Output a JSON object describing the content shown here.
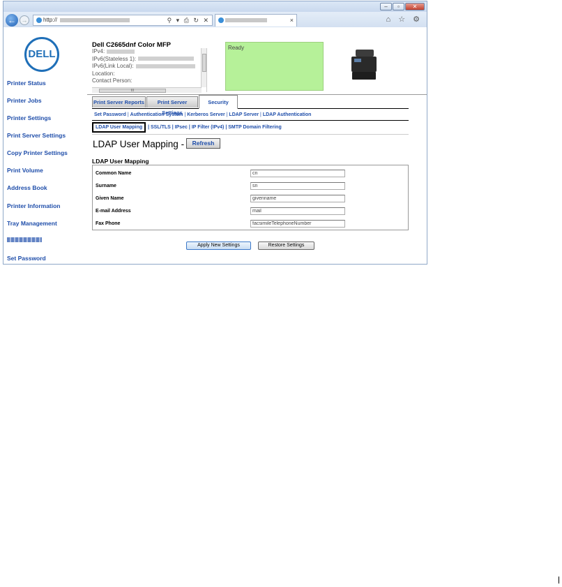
{
  "browser": {
    "address_prefix": "http://",
    "tab_close": "×",
    "address_tools": "⚲ ▾ ⎙ ↻ ✕",
    "browser_icons": "⌂ ☆ ⚙"
  },
  "window_buttons": {
    "minimize": "–",
    "maximize": "▫",
    "close": "✕"
  },
  "logo": {
    "text": "DELL",
    "color": "#1f6fb8"
  },
  "left_nav": [
    "Printer Status",
    "Printer Jobs",
    "Printer Settings",
    "Print Server Settings",
    "Copy Printer Settings",
    "Print Volume",
    "Address Book",
    "Printer Information",
    "Tray Management",
    "",
    "Set Password"
  ],
  "device": {
    "title": "Dell C2665dnf Color MFP",
    "ipv4_label": "IPv4:",
    "ipv6_stateless_label": "IPv6(Stateless 1):",
    "ipv6_link_label": "IPv6(Link Local):",
    "location_label": "Location:",
    "contact_label": "Contact Person:",
    "h_scroll_label": "III"
  },
  "status": {
    "text": "Ready",
    "color": "#b6f199"
  },
  "tabs": [
    {
      "label": "Print Server Reports",
      "active": false
    },
    {
      "label": "Print Server Settings",
      "active": false
    },
    {
      "label": "Security",
      "active": true
    }
  ],
  "sub_links_row1": [
    "Set Password",
    "Authentication System",
    "Kerberos Server",
    "LDAP Server",
    "LDAP Authentication"
  ],
  "sub_links_row2": [
    "LDAP User Mapping",
    "SSL/TLS",
    "IPsec",
    "IP Filter (IPv4)",
    "SMTP Domain Filtering"
  ],
  "separator": " | ",
  "page": {
    "heading": "LDAP User Mapping -",
    "refresh_label": "Refresh",
    "section_title": "LDAP User Mapping"
  },
  "fields": [
    {
      "label": "Common Name",
      "value": "cn"
    },
    {
      "label": "Surname",
      "value": "sn"
    },
    {
      "label": "Given Name",
      "value": "givenname"
    },
    {
      "label": "E-mail Address",
      "value": "mail"
    },
    {
      "label": "Fax Phone",
      "value": "facsimileTelephoneNumber"
    }
  ],
  "buttons": {
    "apply": "Apply New Settings",
    "restore": "Restore Settings"
  }
}
